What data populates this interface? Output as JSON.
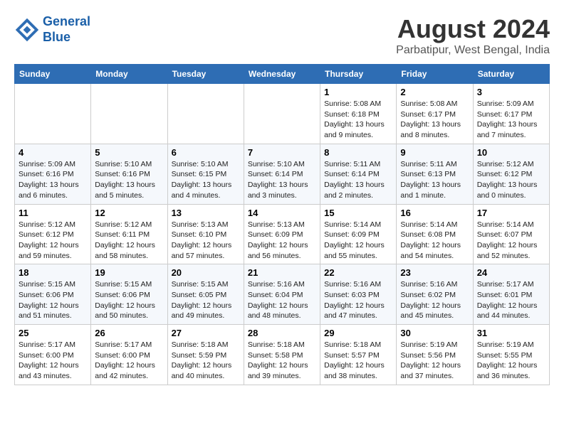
{
  "header": {
    "logo_line1": "General",
    "logo_line2": "Blue",
    "month_year": "August 2024",
    "location": "Parbatipur, West Bengal, India"
  },
  "days_of_week": [
    "Sunday",
    "Monday",
    "Tuesday",
    "Wednesday",
    "Thursday",
    "Friday",
    "Saturday"
  ],
  "weeks": [
    [
      {
        "day": "",
        "info": ""
      },
      {
        "day": "",
        "info": ""
      },
      {
        "day": "",
        "info": ""
      },
      {
        "day": "",
        "info": ""
      },
      {
        "day": "1",
        "info": "Sunrise: 5:08 AM\nSunset: 6:18 PM\nDaylight: 13 hours\nand 9 minutes."
      },
      {
        "day": "2",
        "info": "Sunrise: 5:08 AM\nSunset: 6:17 PM\nDaylight: 13 hours\nand 8 minutes."
      },
      {
        "day": "3",
        "info": "Sunrise: 5:09 AM\nSunset: 6:17 PM\nDaylight: 13 hours\nand 7 minutes."
      }
    ],
    [
      {
        "day": "4",
        "info": "Sunrise: 5:09 AM\nSunset: 6:16 PM\nDaylight: 13 hours\nand 6 minutes."
      },
      {
        "day": "5",
        "info": "Sunrise: 5:10 AM\nSunset: 6:16 PM\nDaylight: 13 hours\nand 5 minutes."
      },
      {
        "day": "6",
        "info": "Sunrise: 5:10 AM\nSunset: 6:15 PM\nDaylight: 13 hours\nand 4 minutes."
      },
      {
        "day": "7",
        "info": "Sunrise: 5:10 AM\nSunset: 6:14 PM\nDaylight: 13 hours\nand 3 minutes."
      },
      {
        "day": "8",
        "info": "Sunrise: 5:11 AM\nSunset: 6:14 PM\nDaylight: 13 hours\nand 2 minutes."
      },
      {
        "day": "9",
        "info": "Sunrise: 5:11 AM\nSunset: 6:13 PM\nDaylight: 13 hours\nand 1 minute."
      },
      {
        "day": "10",
        "info": "Sunrise: 5:12 AM\nSunset: 6:12 PM\nDaylight: 13 hours\nand 0 minutes."
      }
    ],
    [
      {
        "day": "11",
        "info": "Sunrise: 5:12 AM\nSunset: 6:12 PM\nDaylight: 12 hours\nand 59 minutes."
      },
      {
        "day": "12",
        "info": "Sunrise: 5:12 AM\nSunset: 6:11 PM\nDaylight: 12 hours\nand 58 minutes."
      },
      {
        "day": "13",
        "info": "Sunrise: 5:13 AM\nSunset: 6:10 PM\nDaylight: 12 hours\nand 57 minutes."
      },
      {
        "day": "14",
        "info": "Sunrise: 5:13 AM\nSunset: 6:09 PM\nDaylight: 12 hours\nand 56 minutes."
      },
      {
        "day": "15",
        "info": "Sunrise: 5:14 AM\nSunset: 6:09 PM\nDaylight: 12 hours\nand 55 minutes."
      },
      {
        "day": "16",
        "info": "Sunrise: 5:14 AM\nSunset: 6:08 PM\nDaylight: 12 hours\nand 54 minutes."
      },
      {
        "day": "17",
        "info": "Sunrise: 5:14 AM\nSunset: 6:07 PM\nDaylight: 12 hours\nand 52 minutes."
      }
    ],
    [
      {
        "day": "18",
        "info": "Sunrise: 5:15 AM\nSunset: 6:06 PM\nDaylight: 12 hours\nand 51 minutes."
      },
      {
        "day": "19",
        "info": "Sunrise: 5:15 AM\nSunset: 6:06 PM\nDaylight: 12 hours\nand 50 minutes."
      },
      {
        "day": "20",
        "info": "Sunrise: 5:15 AM\nSunset: 6:05 PM\nDaylight: 12 hours\nand 49 minutes."
      },
      {
        "day": "21",
        "info": "Sunrise: 5:16 AM\nSunset: 6:04 PM\nDaylight: 12 hours\nand 48 minutes."
      },
      {
        "day": "22",
        "info": "Sunrise: 5:16 AM\nSunset: 6:03 PM\nDaylight: 12 hours\nand 47 minutes."
      },
      {
        "day": "23",
        "info": "Sunrise: 5:16 AM\nSunset: 6:02 PM\nDaylight: 12 hours\nand 45 minutes."
      },
      {
        "day": "24",
        "info": "Sunrise: 5:17 AM\nSunset: 6:01 PM\nDaylight: 12 hours\nand 44 minutes."
      }
    ],
    [
      {
        "day": "25",
        "info": "Sunrise: 5:17 AM\nSunset: 6:00 PM\nDaylight: 12 hours\nand 43 minutes."
      },
      {
        "day": "26",
        "info": "Sunrise: 5:17 AM\nSunset: 6:00 PM\nDaylight: 12 hours\nand 42 minutes."
      },
      {
        "day": "27",
        "info": "Sunrise: 5:18 AM\nSunset: 5:59 PM\nDaylight: 12 hours\nand 40 minutes."
      },
      {
        "day": "28",
        "info": "Sunrise: 5:18 AM\nSunset: 5:58 PM\nDaylight: 12 hours\nand 39 minutes."
      },
      {
        "day": "29",
        "info": "Sunrise: 5:18 AM\nSunset: 5:57 PM\nDaylight: 12 hours\nand 38 minutes."
      },
      {
        "day": "30",
        "info": "Sunrise: 5:19 AM\nSunset: 5:56 PM\nDaylight: 12 hours\nand 37 minutes."
      },
      {
        "day": "31",
        "info": "Sunrise: 5:19 AM\nSunset: 5:55 PM\nDaylight: 12 hours\nand 36 minutes."
      }
    ]
  ]
}
